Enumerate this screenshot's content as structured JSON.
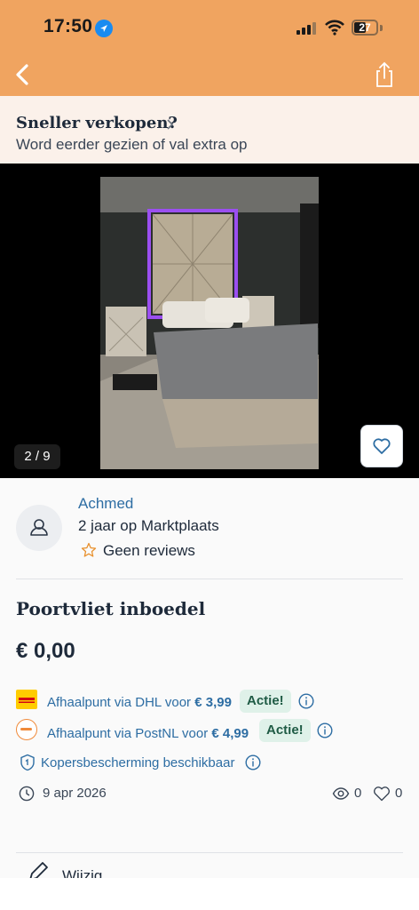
{
  "status_bar": {
    "time": "17:50",
    "battery": "27"
  },
  "promo": {
    "title": "Sneller verkopen?",
    "subtitle": "Word eerder gezien of val extra op"
  },
  "gallery": {
    "counter": "2 / 9"
  },
  "seller": {
    "name": "Achmed",
    "years": "2 jaar op Marktplaats",
    "reviews": "Geen reviews"
  },
  "listing": {
    "title": "Poortvliet inboedel",
    "price": "€ 0,00"
  },
  "shipping": [
    {
      "label": "Afhaalpunt via DHL voor",
      "price": "€ 3,99",
      "badge": "Actie!"
    },
    {
      "label": "Afhaalpunt via PostNL voor",
      "price": "€ 4,99",
      "badge": "Actie!"
    }
  ],
  "protection": {
    "label": "Kopersbescherming beschikbaar"
  },
  "meta": {
    "date": "9 apr 2026",
    "views": "0",
    "likes": "0"
  },
  "edit": {
    "label": "Wijzig"
  },
  "colors": {
    "header": "#f0a460",
    "link": "#2d6da3",
    "badge_bg": "#dff1e9"
  }
}
